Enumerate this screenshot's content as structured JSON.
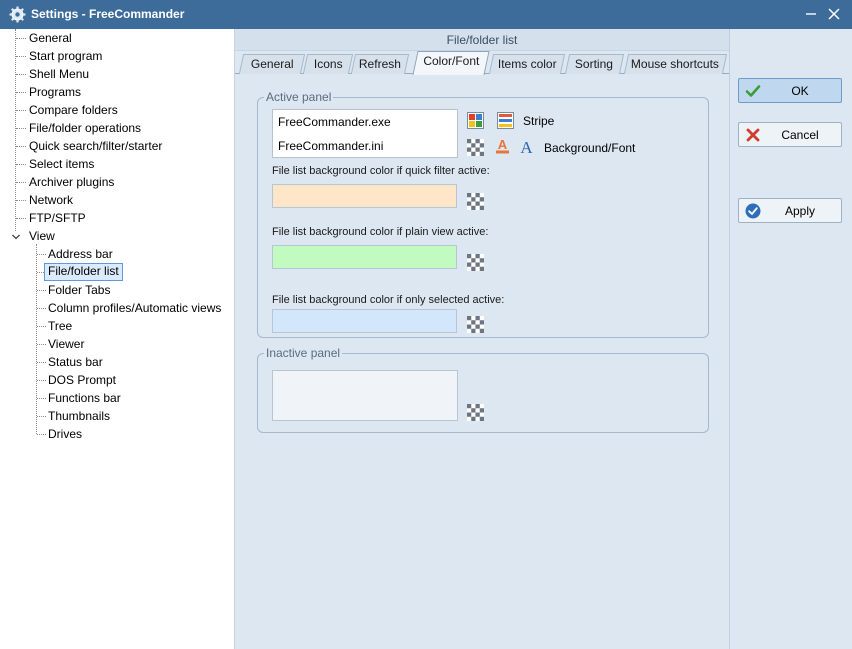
{
  "window": {
    "title": "Settings - FreeCommander",
    "app_icon": "gear-icon",
    "minimize": "minimize-icon",
    "close": "close-icon"
  },
  "tree": {
    "items": [
      {
        "label": "General"
      },
      {
        "label": "Start program"
      },
      {
        "label": "Shell Menu"
      },
      {
        "label": "Programs"
      },
      {
        "label": "Compare folders"
      },
      {
        "label": "File/folder operations"
      },
      {
        "label": "Quick search/filter/starter"
      },
      {
        "label": "Select items"
      },
      {
        "label": "Archiver plugins"
      },
      {
        "label": "Network"
      },
      {
        "label": "FTP/SFTP"
      },
      {
        "label": "View",
        "expanded": true
      }
    ],
    "children": [
      {
        "label": "Address bar"
      },
      {
        "label": "File/folder list",
        "selected": true
      },
      {
        "label": "Folder Tabs"
      },
      {
        "label": "Column profiles/Automatic views"
      },
      {
        "label": "Tree"
      },
      {
        "label": "Viewer"
      },
      {
        "label": "Status bar"
      },
      {
        "label": "DOS Prompt"
      },
      {
        "label": "Functions bar"
      },
      {
        "label": "Thumbnails"
      },
      {
        "label": "Drives"
      }
    ]
  },
  "main": {
    "section_title": "File/folder list",
    "tabs": [
      {
        "label": "General"
      },
      {
        "label": "Icons"
      },
      {
        "label": "Refresh"
      },
      {
        "label": "Color/Font",
        "active": true
      },
      {
        "label": "Items color"
      },
      {
        "label": "Sorting"
      },
      {
        "label": "Mouse shortcuts"
      }
    ],
    "active_panel": {
      "label": "Active panel",
      "list_rows": [
        "FreeCommander.exe",
        "FreeCommander.ini"
      ],
      "stripe_label": "Stripe",
      "background_font_label": "Background/Font",
      "quick_filter_label": "File list background color if quick filter active:",
      "plain_view_label": "File list background color if plain view active:",
      "only_selected_label": "File list background color if only selected active:"
    },
    "inactive_panel": {
      "label": "Inactive panel"
    }
  },
  "colors": {
    "quick_filter_swatch": "#ffe6c8",
    "plain_view_swatch": "#c2fbc0",
    "only_selected_swatch": "#d2e6fc",
    "inactive_swatch": "#f0f3f7",
    "title_bar": "#3d6b9a"
  },
  "buttons": {
    "ok": "OK",
    "cancel": "Cancel",
    "apply": "Apply"
  }
}
